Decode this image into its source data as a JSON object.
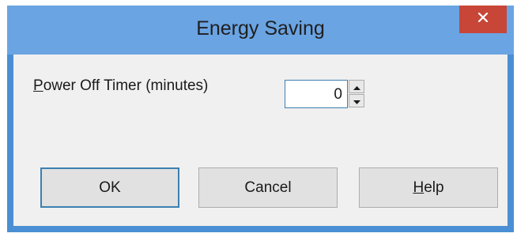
{
  "window": {
    "title": "Energy Saving"
  },
  "power_off_timer": {
    "label_accel": "P",
    "label_rest": "ower Off Timer (minutes)",
    "value": "0"
  },
  "buttons": {
    "ok": "OK",
    "cancel": "Cancel",
    "help_accel": "H",
    "help_rest": "elp"
  },
  "colors": {
    "title_bar": "#6aa4e3",
    "close_button": "#c74638",
    "focus_border": "#3c7fb1"
  },
  "icons": {
    "close": "close-icon",
    "spin_up": "chevron-up-icon",
    "spin_down": "chevron-down-icon"
  }
}
